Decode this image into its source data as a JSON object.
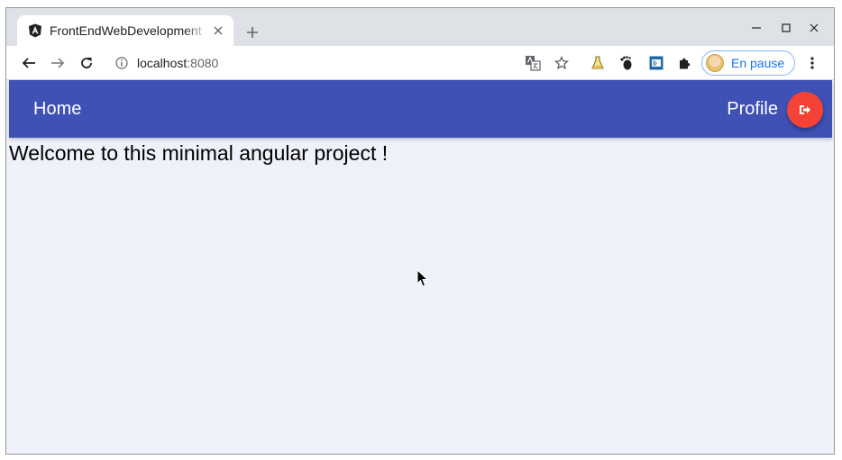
{
  "browser": {
    "tab": {
      "title": "FrontEndWebDevelopment",
      "favicon": "angular-logo-icon"
    },
    "new_tab_symbol": "+",
    "address": {
      "host": "localhost",
      "port": ":8080"
    },
    "profile": {
      "label": "En pause"
    }
  },
  "app": {
    "nav": {
      "home_label": "Home",
      "profile_label": "Profile",
      "logout_icon": "logout-icon"
    },
    "welcome_text": "Welcome to this minimal angular project !",
    "colors": {
      "toolbar": "#3f51b5",
      "fab": "#f44336",
      "background": "#eef1fa"
    }
  }
}
